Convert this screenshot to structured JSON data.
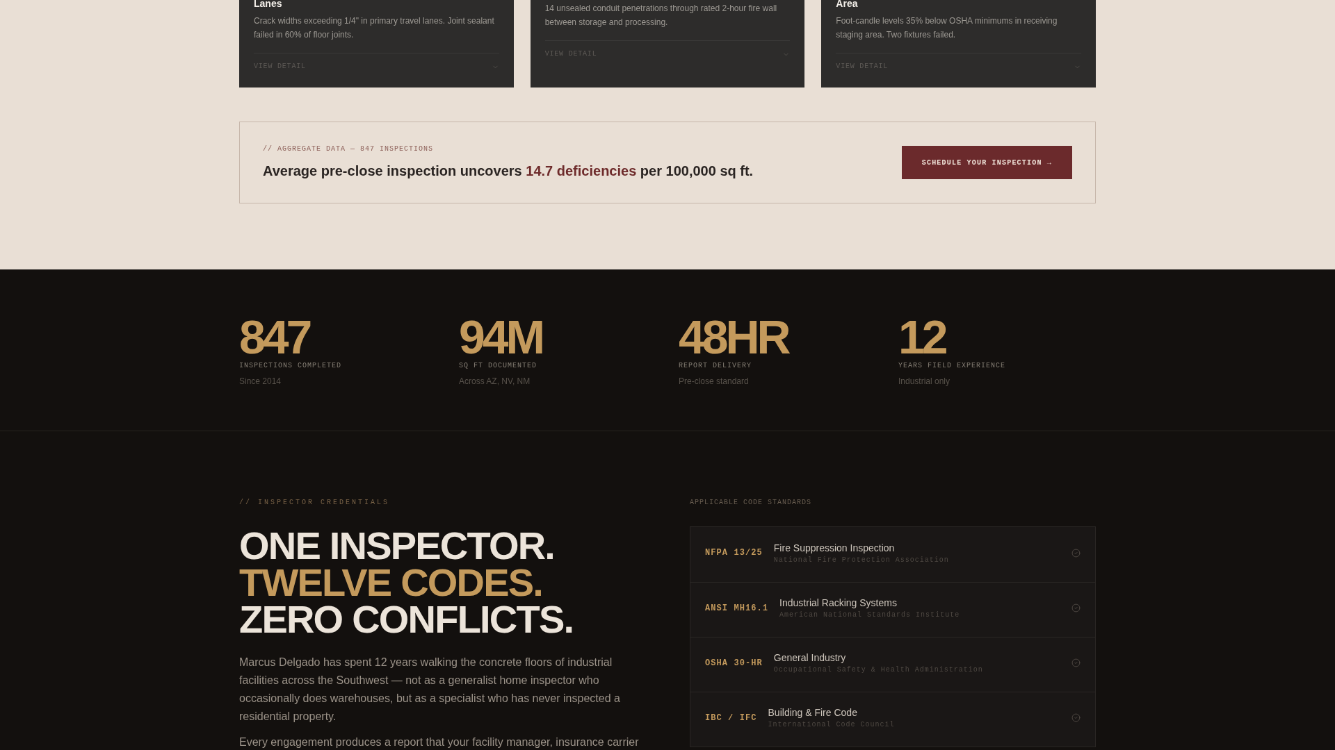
{
  "finding_cards": [
    {
      "title": "Lanes",
      "description": "Crack widths exceeding 1/4\" in primary travel lanes. Joint sealant failed in 60% of floor joints.",
      "action": "VIEW DETAIL"
    },
    {
      "description": "14 unsealed conduit penetrations through rated 2-hour fire wall between storage and processing.",
      "action": "VIEW DETAIL"
    },
    {
      "title": "Area",
      "description": "Foot-candle levels 35% below OSHA minimums in receiving staging area. Two fixtures failed.",
      "action": "VIEW DETAIL"
    }
  ],
  "aggregate": {
    "label": "// AGGREGATE DATA — 847 INSPECTIONS",
    "headline": [
      {
        "text": "Average pre-close inspection uncovers",
        "highlighted": false
      },
      {
        "text": "14.7 deficiencies",
        "highlighted": true
      },
      {
        "text": "per 100,000 sq ft.",
        "highlighted": false
      }
    ],
    "button": "SCHEDULE YOUR INSPECTION →"
  },
  "stats": [
    {
      "value": "847",
      "label": "INSPECTIONS COMPLETED",
      "note": "Since 2014"
    },
    {
      "value": "94M",
      "label": "SQ FT DOCUMENTED",
      "note": "Across AZ, NV, NM"
    },
    {
      "value": "48HR",
      "label": "REPORT DELIVERY",
      "note": "Pre-close standard"
    },
    {
      "value": "12",
      "label": "YEARS FIELD EXPERIENCE",
      "note": "Industrial only"
    }
  ],
  "credentials": {
    "eyebrow": "// INSPECTOR CREDENTIALS",
    "heading_lines": [
      {
        "text": "ONE INSPECTOR.",
        "highlighted": false
      },
      {
        "text": "TWELVE CODES.",
        "highlighted": true
      },
      {
        "text": "ZERO CONFLICTS.",
        "highlighted": false
      }
    ],
    "paragraphs": [
      "Marcus Delgado has spent 12 years walking the concrete floors of industrial facilities across the Southwest — not as a generalist home inspector who occasionally does warehouses, but as a specialist who has never inspected a residential property.",
      "Every engagement produces a report that your facility manager, insurance carrier"
    ]
  },
  "code_standards": {
    "label": "APPLICABLE CODE STANDARDS",
    "items": [
      {
        "code": "NFPA 13/25",
        "title": "Fire Suppression Inspection",
        "body": "National Fire Protection Association"
      },
      {
        "code": "ANSI MH16.1",
        "title": "Industrial Racking Systems",
        "body": "American National Standards Institute"
      },
      {
        "code": "OSHA 30-HR",
        "title": "General Industry",
        "body": "Occupational Safety & Health Administration"
      },
      {
        "code": "IBC / IFC",
        "title": "Building & Fire Code",
        "body": "International Code Council"
      }
    ]
  }
}
